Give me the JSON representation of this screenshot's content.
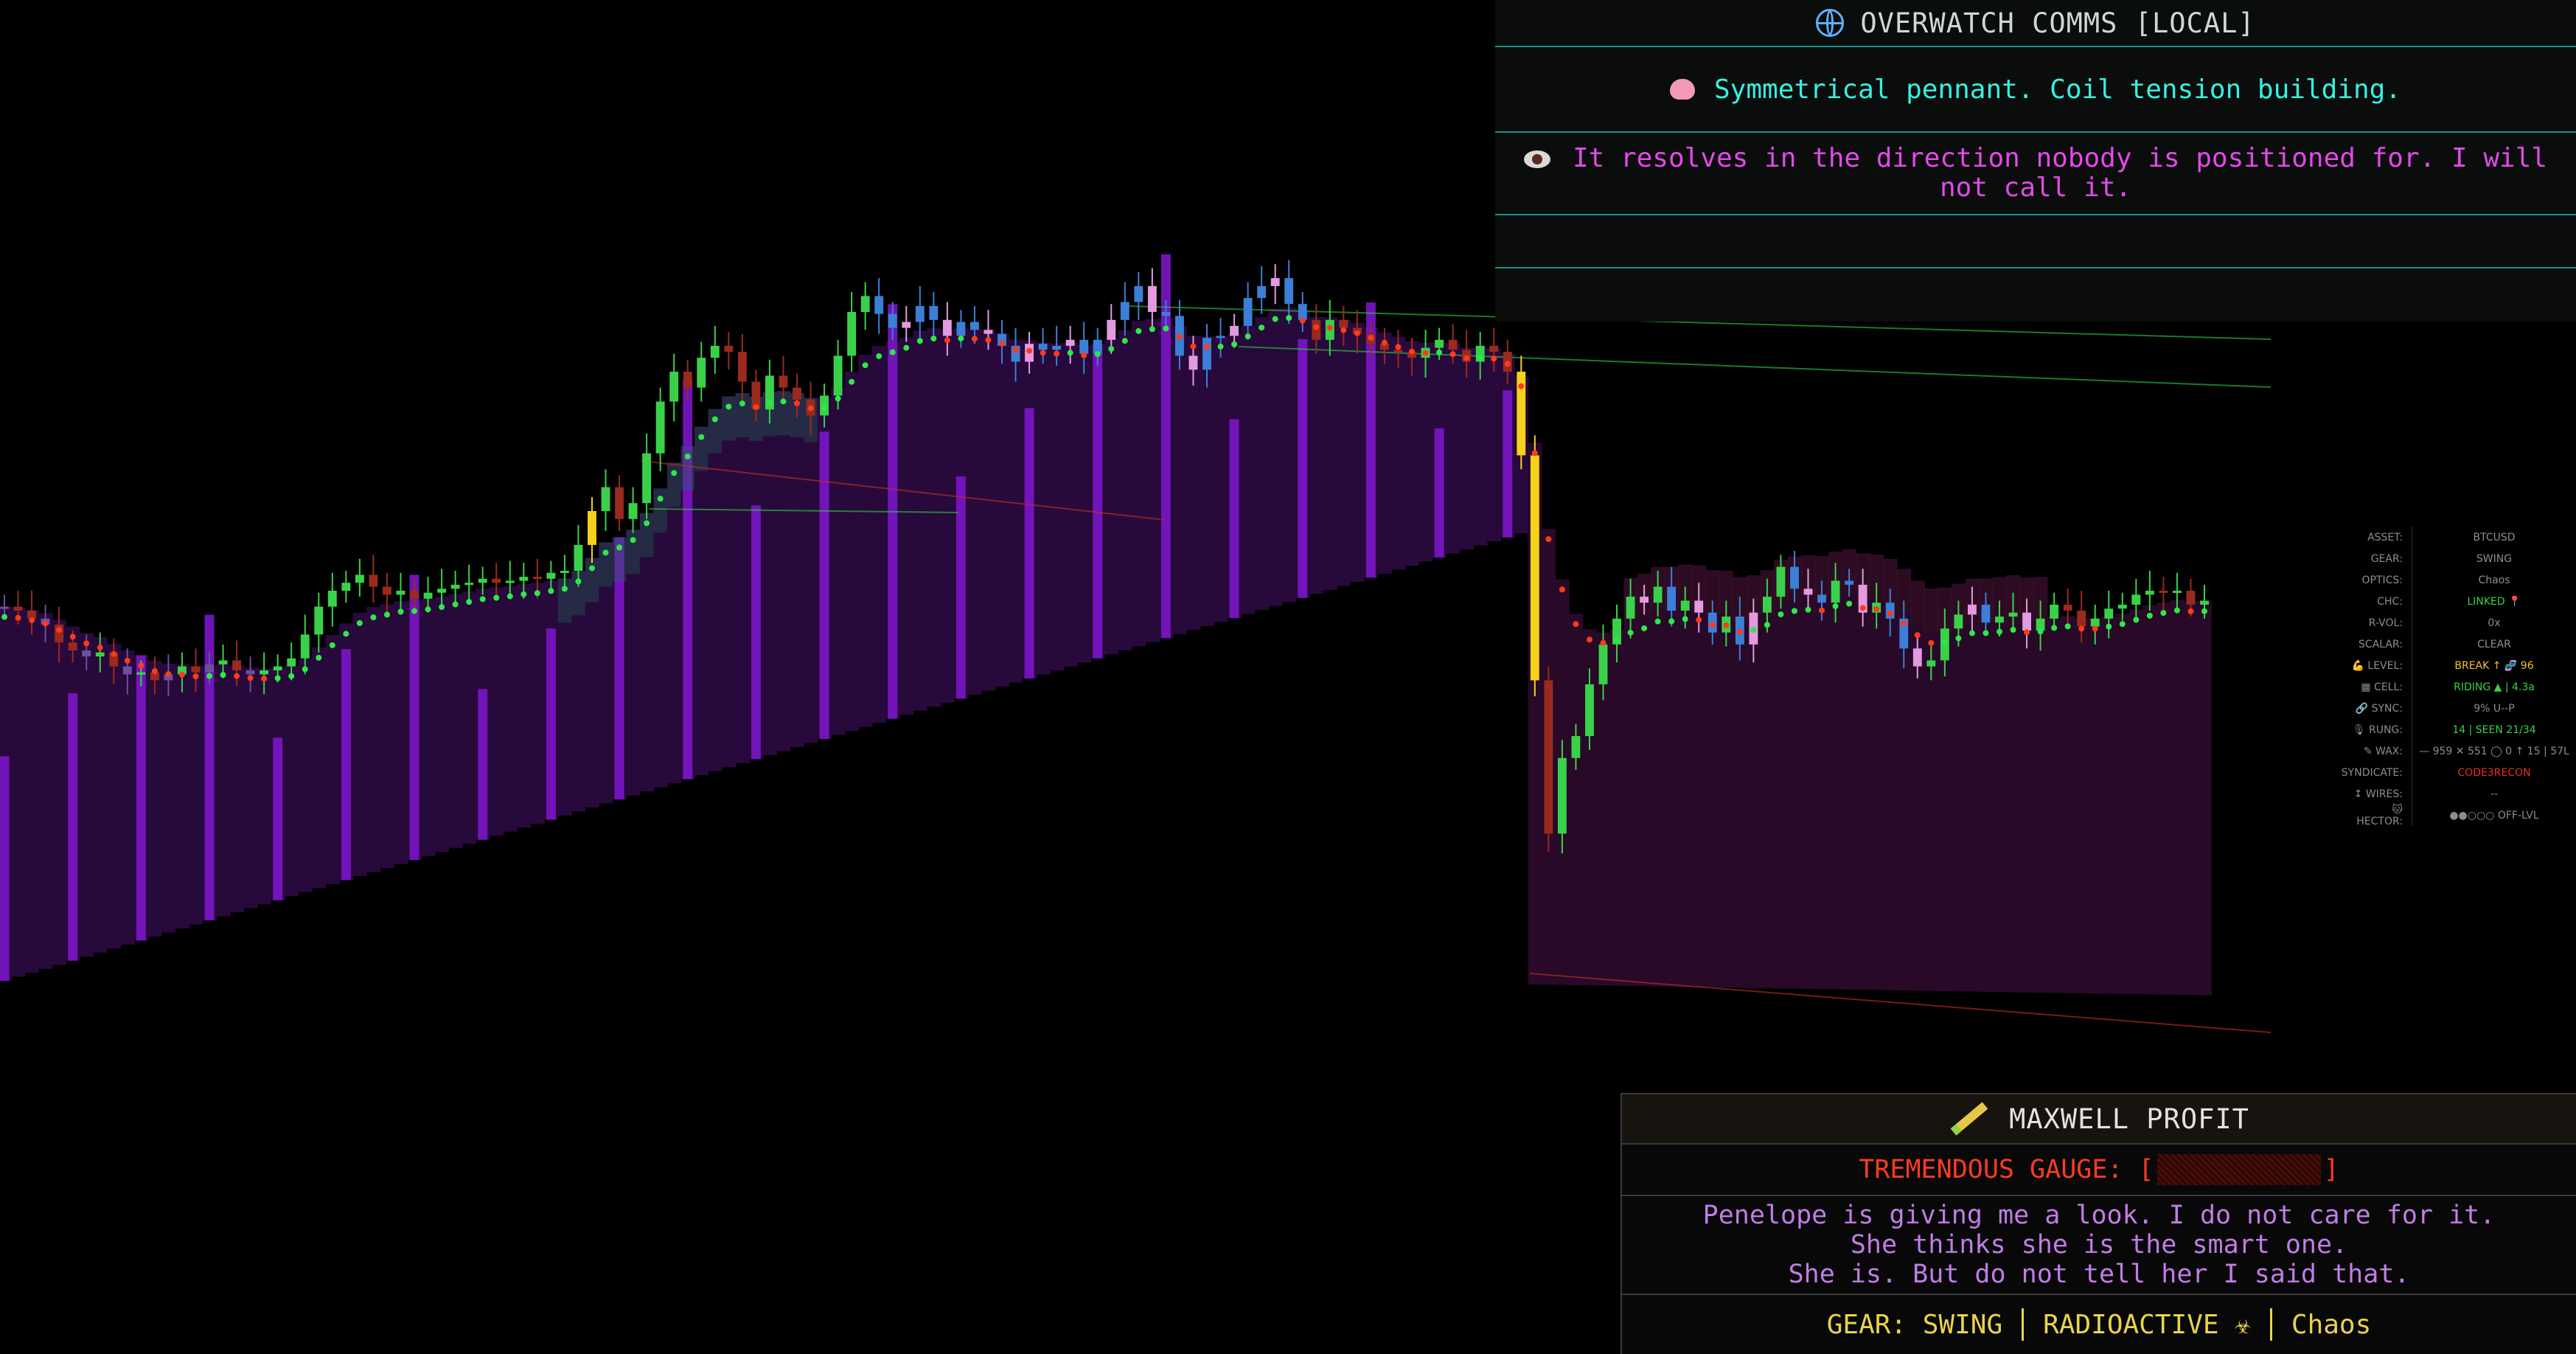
{
  "comms": {
    "title": "OVERWATCH COMMS [LOCAL]",
    "title_icon": "globe-icon",
    "line1": "Symmetrical pennant. Coil tension building.",
    "line1_icon": "brain-icon",
    "line2": "It resolves in the direction nobody is positioned for. I will not call it.",
    "line2_icon": "eye-icon"
  },
  "status": [
    {
      "key": "ASSET:",
      "value": "BTCUSD",
      "color": "#8d8d8d"
    },
    {
      "key": "GEAR:",
      "value": "SWING",
      "color": "#8d8d8d"
    },
    {
      "key": "OPTICS:",
      "value": "Chaos",
      "color": "#8d8d8d"
    },
    {
      "key": "CHC:",
      "value": "LINKED 📍",
      "color": "#3ad14a"
    },
    {
      "key": "R-VOL:",
      "value": "0x",
      "color": "#8d8d8d"
    },
    {
      "key": "SCALAR:",
      "value": "CLEAR",
      "color": "#8d8d8d"
    },
    {
      "key": "💪 LEVEL:",
      "value": "BREAK ↑ 🧬 96",
      "color": "#f2c230"
    },
    {
      "key": "▦ CELL:",
      "value": "RIDING ▲ | 4.3a",
      "color": "#3ad14a"
    },
    {
      "key": "🔗 SYNC:",
      "value": "9% U--P",
      "color": "#8d8d8d"
    },
    {
      "key": "🎙 RUNG:",
      "value": "14 | SEEN 21/34",
      "color": "#3ad14a"
    },
    {
      "key": "✎ WAX:",
      "value": "— 959 ✕ 551 ◯ 0 ↑ 15 | 57L",
      "color": "#8d8d8d"
    },
    {
      "key": "SYNDICATE:",
      "value": "CODE3RECON",
      "color": "#e0301e"
    },
    {
      "key": "↕ WIRES:",
      "value": "--",
      "color": "#8d8d8d"
    },
    {
      "key": "🐱 HECTOR:",
      "value": "●●○○○ OFF-LVL",
      "color": "#8d8d8d"
    }
  ],
  "maxwell": {
    "title": "MAXWELL PROFIT",
    "title_icon": "pencil-icon",
    "gauge_label": "TREMENDOUS GAUGE: [",
    "gauge_close": "]",
    "quote": [
      "Penelope is giving me a look. I do not care for it.",
      "She thinks she is the smart one.",
      "She is. But do not tell her I said that."
    ],
    "gear_left": "GEAR: SWING",
    "gear_mid": "RADIOACTIVE ☣",
    "gear_right": "Chaos"
  },
  "colors": {
    "up": "#3ad14a",
    "down": "#9a2a1e",
    "blue": "#3b7fd8",
    "pink": "#e39ae0",
    "yellow": "#f5d21c",
    "band": "#7a16c9",
    "dot_up": "#2ee84a",
    "dot_down": "#ff3a1a"
  },
  "chart_data": {
    "type": "candlestick",
    "title": "",
    "closes": [
      66.2,
      66.0,
      65.6,
      65.3,
      64.4,
      64.0,
      63.7,
      63.9,
      63.2,
      62.8,
      62.9,
      62.5,
      62.8,
      63.2,
      62.9,
      63.3,
      63.5,
      63.0,
      62.8,
      63.0,
      63.2,
      63.6,
      64.8,
      66.2,
      67.0,
      67.4,
      67.8,
      67.2,
      66.8,
      67.0,
      66.6,
      66.9,
      67.1,
      67.3,
      67.4,
      67.6,
      67.4,
      67.5,
      67.7,
      67.6,
      67.9,
      68.0,
      69.3,
      71.0,
      72.2,
      70.6,
      71.4,
      73.9,
      76.5,
      78.0,
      77.2,
      78.7,
      79.3,
      79.0,
      77.5,
      76.1,
      77.8,
      77.2,
      76.6,
      75.8,
      76.8,
      78.8,
      81.0,
      81.8,
      80.9,
      80.2,
      80.5,
      81.3,
      80.6,
      79.8,
      80.5,
      80.1,
      79.9,
      79.3,
      78.5,
      79.4,
      79.1,
      79.3,
      79.6,
      78.9,
      79.6,
      80.6,
      81.5,
      82.3,
      81.0,
      80.8,
      78.8,
      78.1,
      79.7,
      79.8,
      80.3,
      81.7,
      82.3,
      82.7,
      81.4,
      80.6,
      79.6,
      80.6,
      80.2,
      79.9,
      79.4,
      79.1,
      79.0,
      78.7,
      79.2,
      79.6,
      79.1,
      78.5,
      79.3,
      79.0,
      78.0,
      73.8,
      62.5,
      54.8,
      58.6,
      59.7,
      62.3,
      64.3,
      65.6,
      66.7,
      66.4,
      67.2,
      66.0,
      66.5,
      65.9,
      64.9,
      65.7,
      64.3,
      65.9,
      66.7,
      68.2,
      67.1,
      66.8,
      66.4,
      67.5,
      67.3,
      65.9,
      66.4,
      65.6,
      64.1,
      63.2,
      63.5,
      65.1,
      65.8,
      66.3,
      65.4,
      65.7,
      65.9,
      65.0,
      65.6,
      66.3,
      66.0,
      65.2,
      65.6,
      66.1,
      66.3,
      66.8,
      67.0,
      66.9,
      67.0,
      66.3,
      66.5
    ],
    "note": "approximate BTCUSD swing candles; many oscillator/bands are decorative overlays"
  }
}
